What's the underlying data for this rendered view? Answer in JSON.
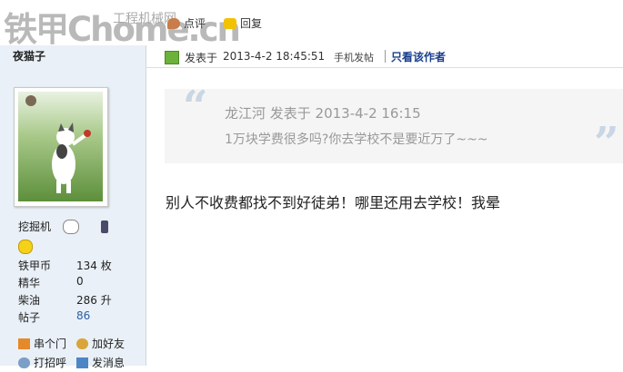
{
  "logo": {
    "main": "铁甲Chome.cn",
    "sub": "工程机械网"
  },
  "toolbar": {
    "comment_label": "点评",
    "reply_label": "回复"
  },
  "user": {
    "name": "夜猫子",
    "rank_title": "挖掘机",
    "stats": [
      {
        "label": "铁甲币",
        "value": "134 枚"
      },
      {
        "label": "精华",
        "value": "0"
      },
      {
        "label": "柴油",
        "value": "286 升"
      },
      {
        "label": "帖子",
        "value": "86"
      }
    ],
    "actions": [
      {
        "label": "串个门",
        "icon": "home-icon"
      },
      {
        "label": "加好友",
        "icon": "add-friend-icon"
      },
      {
        "label": "打招呼",
        "icon": "wave-icon"
      },
      {
        "label": "发消息",
        "icon": "mail-icon"
      }
    ]
  },
  "post": {
    "posted_label": "发表于",
    "time": "2013-4-2 18:45:51",
    "via": "手机发帖",
    "author_only": "只看该作者",
    "quote": {
      "header": "龙江河  发表于  2013-4-2 16:15",
      "text": "1万块学费很多吗?你去学校不是要近万了~~~"
    },
    "body": "别人不收费都找不到好徒弟！哪里还用去学校！我晕"
  }
}
